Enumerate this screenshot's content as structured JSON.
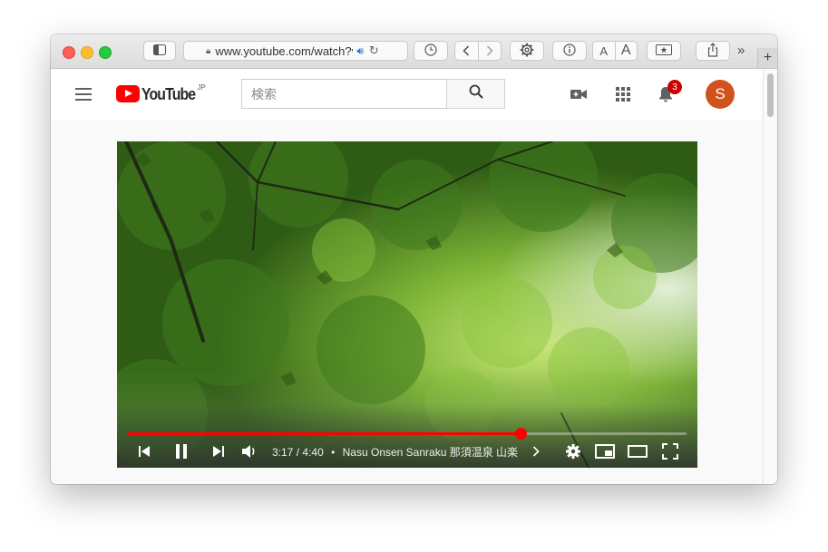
{
  "browser": {
    "url": "www.youtube.com/watch?v",
    "text_smaller": "A",
    "text_larger": "A"
  },
  "youtube": {
    "region": "JP",
    "logo_text": "YouTube",
    "search_placeholder": "検索",
    "notification_count": "3",
    "avatar_initial": "S"
  },
  "player": {
    "current_time": "3:17",
    "duration": "4:40",
    "separator": "/",
    "bullet": "•",
    "title": "Nasu Onsen Sanraku 那須温泉 山楽",
    "progress_fraction": 0.7036,
    "colors": {
      "progress": "#ff0000",
      "accent": "#cc0000"
    }
  },
  "icons": [
    "sidebar-icon",
    "lock-icon",
    "speaker-icon",
    "reload-icon",
    "history-icon",
    "back-icon",
    "forward-icon",
    "gear-icon",
    "info-icon",
    "reader-icon",
    "share-icon",
    "overflow-icon",
    "new-tab-icon",
    "menu-icon",
    "search-icon",
    "create-video-icon",
    "apps-icon",
    "bell-icon",
    "previous-icon",
    "pause-icon",
    "next-icon",
    "volume-icon",
    "settings-icon",
    "miniplayer-icon",
    "theater-icon",
    "fullscreen-icon"
  ]
}
